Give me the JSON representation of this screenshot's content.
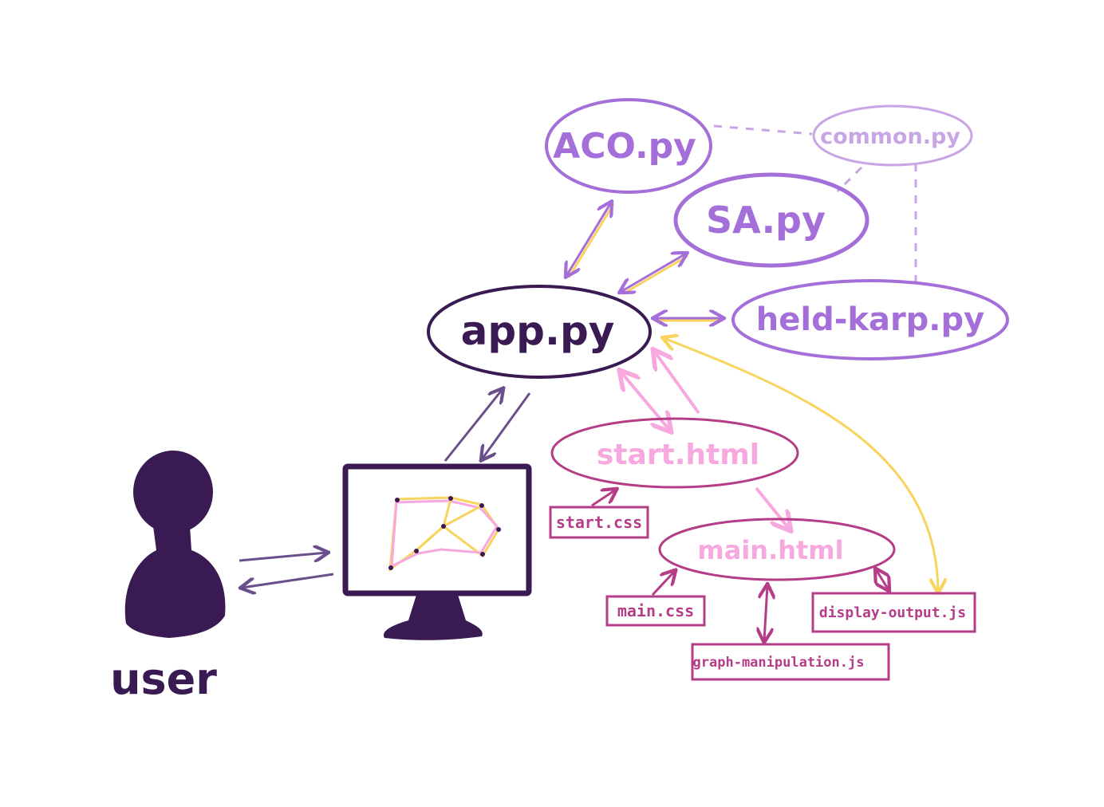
{
  "colors": {
    "dark_purple": "#3a1a52",
    "medium_purple": "#a46fd9",
    "light_purple": "#c8a6e6",
    "pink": "#f7a8de",
    "magenta": "#b53c86",
    "yellow": "#f8d35e",
    "arrow_dark": "#6b4f8c"
  },
  "nodes": {
    "aco": "ACO.py",
    "common": "common.py",
    "sa": "SA.py",
    "heldkarp": "held-karp.py",
    "app": "app.py",
    "start_html": "start.html",
    "main_html": "main.html"
  },
  "files": {
    "start_css": "start.css",
    "main_css": "main.css",
    "display_output": "display-output.js",
    "graph_manipulation": "graph-manipulation.js"
  },
  "actor": {
    "label": "user",
    "icon": "person-icon"
  },
  "screen": {
    "icon": "monitor-icon",
    "content": "graph-drawing"
  }
}
